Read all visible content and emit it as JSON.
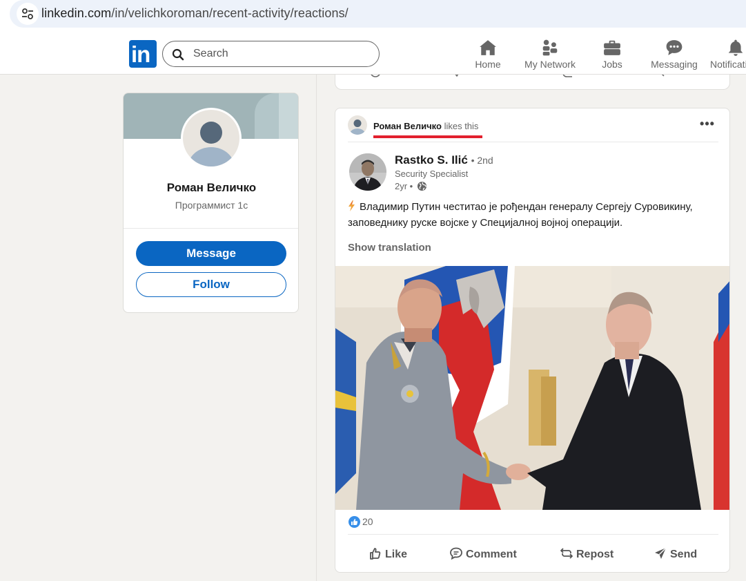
{
  "browser": {
    "url_host": "linkedin.com",
    "url_path": "/in/velichkoroman/recent-activity/reactions/"
  },
  "header": {
    "logo_text": "in",
    "search_placeholder": "Search",
    "nav": [
      {
        "label": "Home",
        "icon": "home-icon"
      },
      {
        "label": "My Network",
        "icon": "network-icon"
      },
      {
        "label": "Jobs",
        "icon": "briefcase-icon"
      },
      {
        "label": "Messaging",
        "icon": "chat-icon"
      },
      {
        "label": "Notificati",
        "icon": "bell-icon"
      }
    ]
  },
  "profile": {
    "name": "Роман Величко",
    "title": "Программист 1с",
    "message_label": "Message",
    "follow_label": "Follow"
  },
  "post": {
    "activity_actor": "Роман Величко",
    "activity_verb": "likes this",
    "author_name": "Rastko S. Ilić",
    "author_degree": "• 2nd",
    "author_headline": "Security Specialist",
    "author_time": "2yr •",
    "text": "Владимир Путин честитао је рођендан генералу Сергеју Суровикину, заповеднику руске војске у Специјалној војној операцији.",
    "show_translation": "Show translation",
    "reaction_count": "20",
    "actions": [
      "Like",
      "Comment",
      "Repost",
      "Send"
    ]
  },
  "colors": {
    "brand": "#0a66c2",
    "highlight": "#e2202d"
  }
}
